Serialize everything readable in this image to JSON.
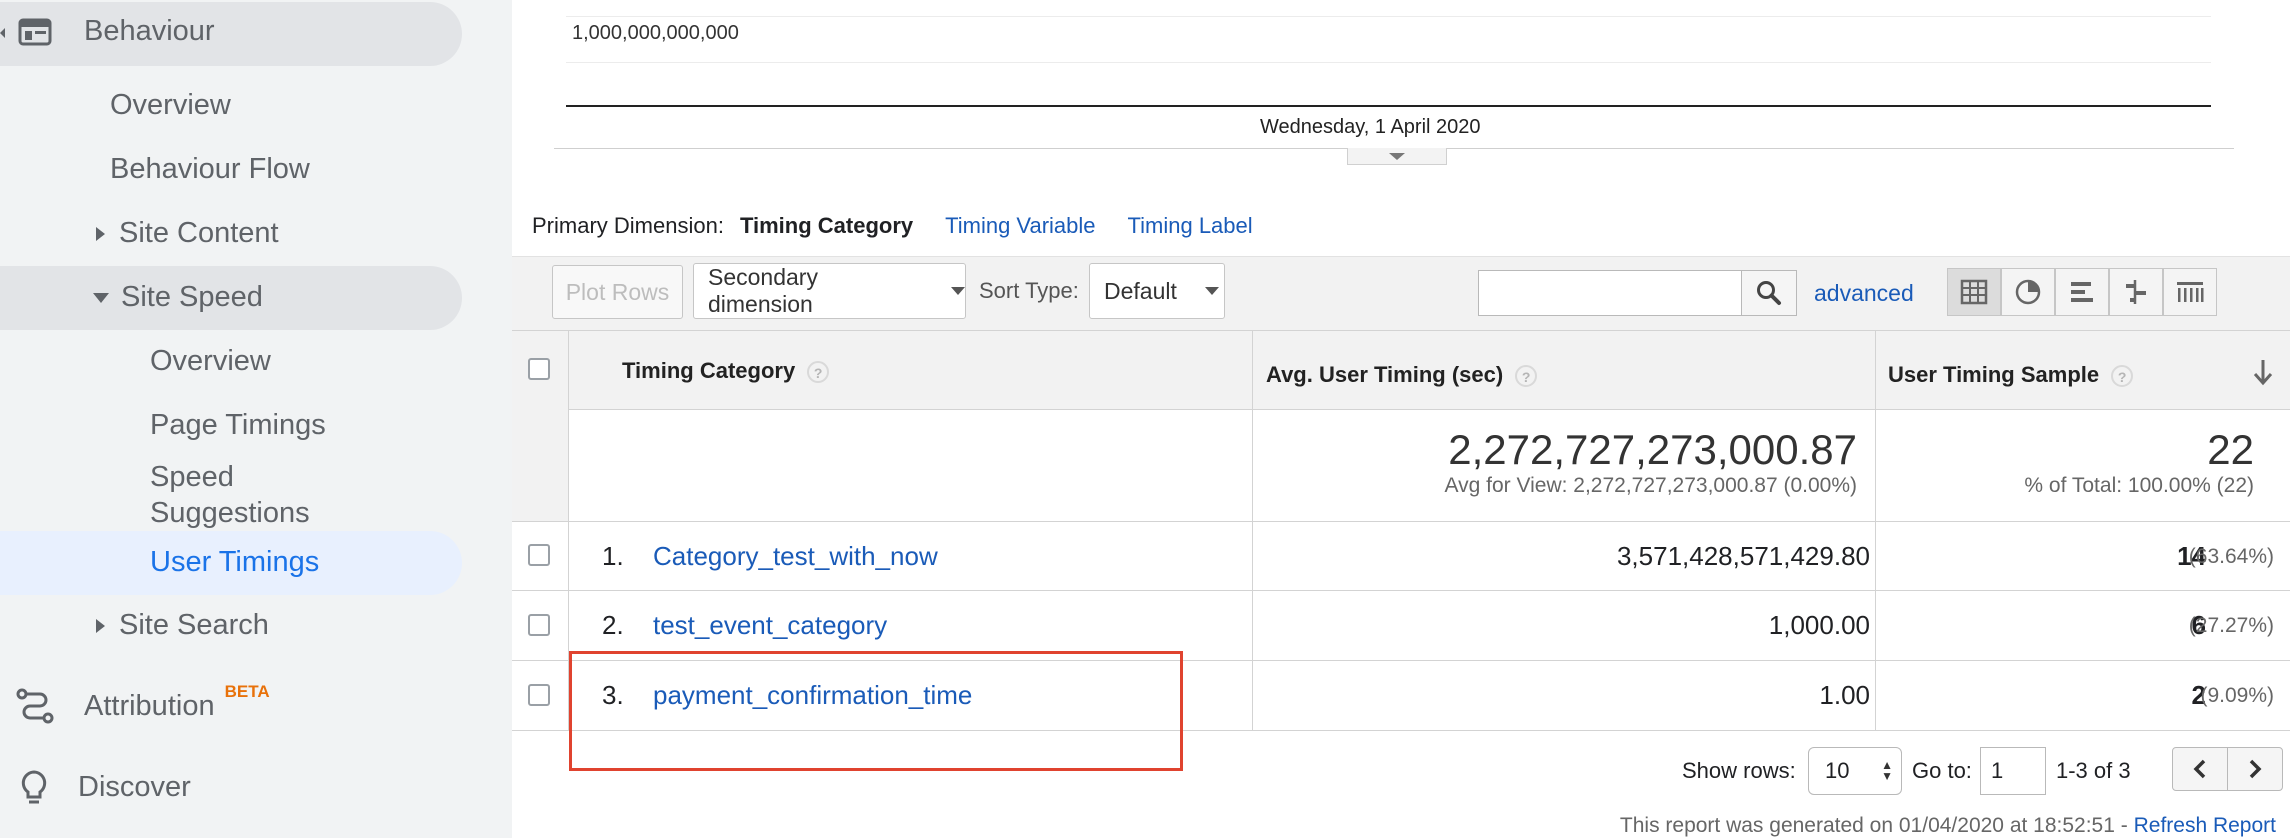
{
  "sidebar": {
    "behaviour": "Behaviour",
    "overview": "Overview",
    "behaviour_flow": "Behaviour Flow",
    "site_content": "Site Content",
    "site_speed": "Site Speed",
    "speed_overview": "Overview",
    "page_timings": "Page Timings",
    "speed_suggestions_line1": "Speed",
    "speed_suggestions_line2": "Suggestions",
    "user_timings": "User Timings",
    "site_search": "Site Search",
    "attribution": "Attribution",
    "attribution_badge": "BETA",
    "discover": "Discover"
  },
  "chart": {
    "y_tick": "1,000,000,000,000",
    "x_date": "Wednesday, 1 April 2020"
  },
  "dimension": {
    "label": "Primary Dimension:",
    "selected": "Timing Category",
    "option_variable": "Timing Variable",
    "option_label": "Timing Label"
  },
  "toolbar": {
    "plot_rows": "Plot Rows",
    "secondary_dimension": "Secondary dimension",
    "sort_type_label": "Sort Type:",
    "sort_type_value": "Default",
    "search_value": "",
    "advanced": "advanced"
  },
  "table": {
    "columns": [
      "Timing Category",
      "Avg. User Timing (sec)",
      "User Timing Sample"
    ],
    "totals": {
      "avg_timing": "2,272,727,273,000.87",
      "avg_timing_sub": "Avg for View: 2,272,727,273,000.87 (0.00%)",
      "sample": "22",
      "sample_sub": "% of Total: 100.00% (22)"
    },
    "rows": [
      {
        "index": "1.",
        "category": "Category_test_with_now",
        "avg_timing": "3,571,428,571,429.80",
        "sample": "14",
        "sample_pct": "(63.64%)"
      },
      {
        "index": "2.",
        "category": "test_event_category",
        "avg_timing": "1,000.00",
        "sample": "6",
        "sample_pct": "(27.27%)"
      },
      {
        "index": "3.",
        "category": "payment_confirmation_time",
        "avg_timing": "1.00",
        "sample": "2",
        "sample_pct": "(9.09%)"
      }
    ]
  },
  "pagination": {
    "show_rows_label": "Show rows:",
    "show_rows_value": "10",
    "goto_label": "Go to:",
    "goto_value": "1",
    "range": "1-3 of 3"
  },
  "footer": {
    "generated": "This report was generated on 01/04/2020 at 18:52:51 -",
    "refresh": "Refresh Report"
  },
  "colors": {
    "link": "#1a5bb8",
    "highlight_box": "#e0432f",
    "sidebar_bg": "#f1f3f4",
    "active_item_bg": "#e8f0fe"
  },
  "icons": [
    "layout-icon",
    "attribution-icon",
    "lightbulb-icon",
    "search-icon",
    "table-view-icon",
    "pie-view-icon",
    "bar-view-icon",
    "comparison-view-icon",
    "pivot-view-icon",
    "sort-desc-arrow-icon",
    "prev-page-icon",
    "next-page-icon"
  ]
}
